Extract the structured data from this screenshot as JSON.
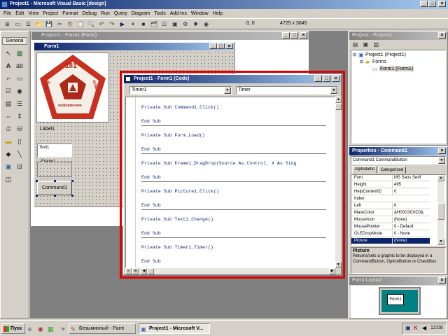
{
  "app": {
    "title": "Project1 - Microsoft Visual Basic [design]"
  },
  "menu": [
    "File",
    "Edit",
    "View",
    "Project",
    "Format",
    "Debug",
    "Run",
    "Query",
    "Diagram",
    "Tools",
    "Add-Ins",
    "Window",
    "Help"
  ],
  "toolbar": {
    "position": "0, 0",
    "size": "4725 x 3645"
  },
  "toolbox": {
    "title": "General"
  },
  "form_designer": {
    "window_title": "Project1 - Form1 (Form)",
    "form_title": "Form1",
    "label1": "Label1",
    "text1": "Text1",
    "frame1": "Frame1",
    "command1": "Command1",
    "logo": {
      "top": "181",
      "left": "моу",
      "right": "сош",
      "bottom": "информатика"
    }
  },
  "code_window": {
    "title": "Project1 - Form1 (Code)",
    "object_combo": "Timer1",
    "procedure_combo": "Timer",
    "lines": [
      "Private Sub Command1_Click()",
      "End Sub",
      "Private Sub Form_Load()",
      "End Sub",
      "Private Sub Frame1_DragDrop(Source As Control, X As Sing",
      "End Sub",
      "Private Sub Picture1_Click()",
      "End Sub",
      "Private Sub Text1_Change()",
      "End Sub",
      "Private Sub Timer1_Timer()",
      "End Sub"
    ],
    "highlight_color": "#e00000"
  },
  "project_explorer": {
    "title": "Project - Project1",
    "root": "Project1 (Project1)",
    "folder": "Forms",
    "item": "Form1 (Form1)"
  },
  "properties": {
    "title": "Properties - Command1",
    "object": "Command1 CommandButton",
    "tabs": [
      "Alphabetic",
      "Categorized"
    ],
    "rows": [
      {
        "k": "Font",
        "v": "MS Sans Serif"
      },
      {
        "k": "Height",
        "v": "495"
      },
      {
        "k": "HelpContextID",
        "v": "0"
      },
      {
        "k": "Index",
        "v": ""
      },
      {
        "k": "Left",
        "v": "0"
      },
      {
        "k": "MaskColor",
        "v": "&H00C0C0C0&"
      },
      {
        "k": "MouseIcon",
        "v": "(None)"
      },
      {
        "k": "MousePointer",
        "v": "0 - Default"
      },
      {
        "k": "OLEDropMode",
        "v": "0 - None"
      },
      {
        "k": "Picture",
        "v": "(None)"
      }
    ],
    "desc_title": "Picture",
    "desc_text": "Returns/sets a graphic to be displayed in a CommandButton, OptionButton or CheckBox"
  },
  "form_layout": {
    "title": "Form Layout",
    "thumb": "Form1"
  },
  "taskbar": {
    "start": "Пуск",
    "task1": "Безымянный - Paint",
    "task2": "Project1 - Microsoft V...",
    "clock": "12:09"
  }
}
